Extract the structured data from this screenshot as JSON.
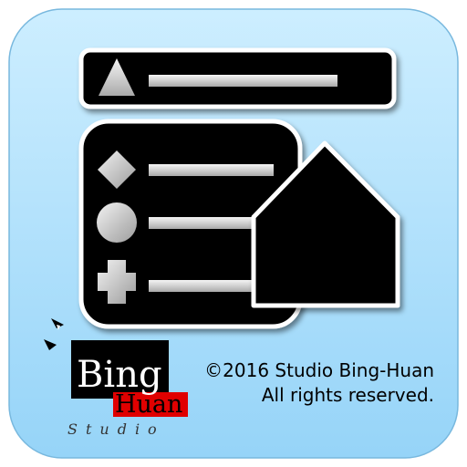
{
  "logo": {
    "word1": "Bing",
    "word2": "Huan",
    "word3": "Studio"
  },
  "copyright": {
    "line1": "©2016 Studio Bing-Huan",
    "line2": "All rights reserved."
  },
  "colors": {
    "background_top": "#c8ebff",
    "background_bottom": "#9dd8fa",
    "panel": "#000000",
    "panel_border": "#ffffff",
    "bar": "#d8d8d8",
    "logo_red": "#e00000"
  },
  "icons": [
    "triangle-icon",
    "diamond-icon",
    "circle-icon",
    "plus-icon",
    "house-icon"
  ]
}
